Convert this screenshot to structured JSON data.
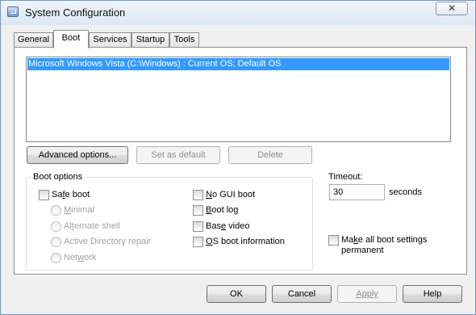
{
  "window": {
    "title": "System Configuration",
    "close_glyph": "✕"
  },
  "tabs": [
    {
      "label": "General",
      "active": false
    },
    {
      "label": "Boot",
      "active": true
    },
    {
      "label": "Services",
      "active": false
    },
    {
      "label": "Startup",
      "active": false
    },
    {
      "label": "Tools",
      "active": false
    }
  ],
  "os_list": {
    "items": [
      "Microsoft Windows Vista (C:\\Windows) : Current OS; Default OS"
    ],
    "selected_index": 0
  },
  "actions": {
    "advanced": "Advanced options...",
    "set_default": "Set as default",
    "delete": "Delete"
  },
  "boot_options": {
    "label": "Boot options",
    "safe_boot": {
      "pre": "Sa",
      "key": "f",
      "post": "e boot",
      "checked": false
    },
    "modes": {
      "minimal": {
        "pre": "",
        "key": "M",
        "post": "inimal",
        "selected": false
      },
      "alternate_shell": {
        "pre": "Al",
        "key": "t",
        "post": "ernate shell",
        "selected": false
      },
      "active_directory": {
        "pre": "Active Directory repair",
        "key": "",
        "post": "",
        "selected": false
      },
      "network": {
        "pre": "Net",
        "key": "w",
        "post": "ork",
        "selected": false
      }
    },
    "no_gui": {
      "pre": "",
      "key": "N",
      "post": "o GUI boot",
      "checked": false
    },
    "boot_log": {
      "pre": "",
      "key": "B",
      "post": "oot log",
      "checked": false
    },
    "base_video": {
      "pre": "Bas",
      "key": "e",
      "post": " video",
      "checked": false
    },
    "os_info": {
      "pre": "",
      "key": "O",
      "post": "S boot information",
      "checked": false
    }
  },
  "timeout": {
    "label": "Timeout:",
    "value": "30",
    "unit": "seconds"
  },
  "permanent": {
    "line1_pre": "Ma",
    "line1_key": "k",
    "line1_post": "e all boot settings",
    "line2": "permanent",
    "checked": false
  },
  "footer": {
    "ok": "OK",
    "cancel": "Cancel",
    "apply": "Apply",
    "help": "Help"
  },
  "colors": {
    "selection": "#3399ff",
    "dialog_bg": "#f0f0f0",
    "disabled_text": "#8d8d8d"
  }
}
